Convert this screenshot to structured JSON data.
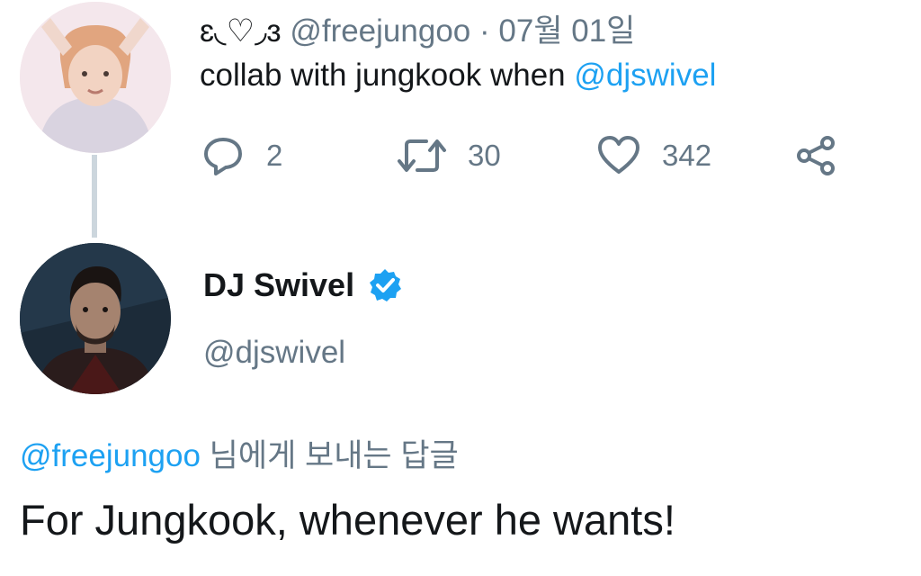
{
  "tweet": {
    "author_name": "ɛ◟♡◞ɜ",
    "handle": "@freejungoo",
    "separator": "·",
    "date": "07월 01일",
    "text_prefix": "collab with jungkook when ",
    "text_mention": "@djswivel",
    "stats": {
      "replies": "2",
      "retweets": "30",
      "likes": "342"
    }
  },
  "reply": {
    "name": "DJ Swivel",
    "verified": true,
    "handle": "@djswivel",
    "reply_to_mention": "@freejungoo",
    "reply_to_suffix": " 님에게 보내는 답글",
    "text": "For Jungkook, whenever he wants!"
  },
  "icons": [
    "reply-icon",
    "retweet-icon",
    "like-icon",
    "share-icon",
    "verified-badge-icon"
  ],
  "colors": {
    "accent": "#1da1f2",
    "muted": "#657786",
    "text": "#14171a",
    "thread_line": "#ccd6dd"
  }
}
